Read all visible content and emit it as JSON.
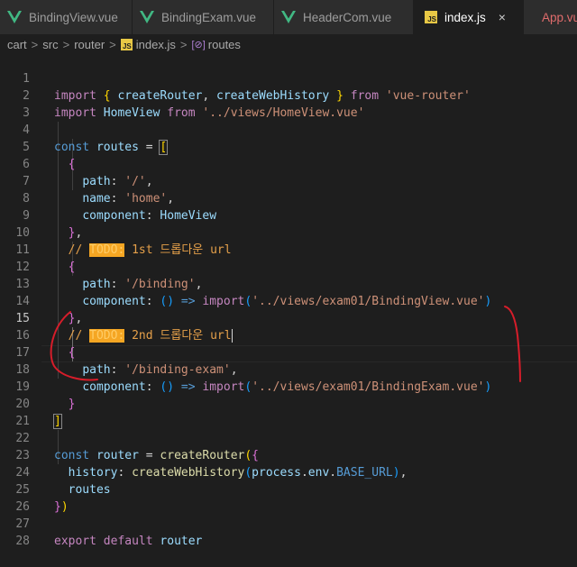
{
  "tabs": [
    {
      "label": "BindingView.vue",
      "icon": "vue-icon",
      "active": false
    },
    {
      "label": "BindingExam.vue",
      "icon": "vue-icon",
      "active": false
    },
    {
      "label": "HeaderCom.vue",
      "icon": "vue-icon",
      "active": false
    },
    {
      "label": "index.js",
      "icon": "js-icon",
      "active": true,
      "close": "×"
    },
    {
      "label": "App.vue",
      "icon": "vue-icon",
      "active": false
    }
  ],
  "breadcrumb": {
    "items": [
      "cart",
      "src",
      "router",
      "index.js",
      "routes"
    ],
    "separator": ">"
  },
  "code": {
    "line_numbers": [
      "1",
      "2",
      "3",
      "4",
      "5",
      "6",
      "7",
      "8",
      "9",
      "10",
      "11",
      "12",
      "13",
      "14",
      "15",
      "16",
      "17",
      "18",
      "19",
      "20",
      "21",
      "22",
      "23",
      "24",
      "25",
      "26",
      "27",
      "28"
    ],
    "current_line": "15",
    "todo_tag": "TODO:",
    "comment_1": " 1st 드롭다운 url",
    "comment_2": " 2nd 드롭다운 url"
  },
  "colors": {
    "accent": "#e8c845",
    "annotation": "#d61d2a",
    "background": "#1e1e1e"
  }
}
